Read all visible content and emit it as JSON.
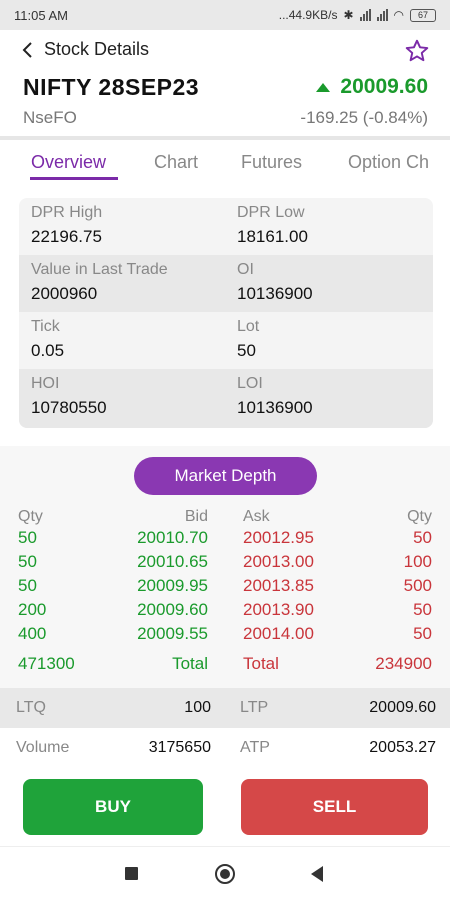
{
  "status_bar": {
    "time": "11:05 AM",
    "net_speed": "...44.9KB/s",
    "battery": "67"
  },
  "header": {
    "title": "Stock Details",
    "symbol": "NIFTY 28SEP23",
    "exchange": "NseFO",
    "ltp": "20009.60",
    "change": "-169.25 (-0.84%)",
    "icons": {
      "back": "chevron-left-icon",
      "favorite": "star-outline-icon",
      "trend": "up-arrow-icon"
    },
    "colors": {
      "up": "#1a9a2c",
      "accent": "#7b2aa8"
    }
  },
  "tabs": [
    {
      "label": "Overview"
    },
    {
      "label": "Chart"
    },
    {
      "label": "Futures"
    },
    {
      "label": "Option Ch"
    }
  ],
  "overview": {
    "rows": [
      [
        {
          "label": "DPR High",
          "value": "22196.75"
        },
        {
          "label": "DPR Low",
          "value": "18161.00"
        }
      ],
      [
        {
          "label": "Value in Last Trade",
          "value": "2000960"
        },
        {
          "label": "OI",
          "value": "10136900"
        }
      ],
      [
        {
          "label": "Tick",
          "value": "0.05"
        },
        {
          "label": "Lot",
          "value": "50"
        }
      ],
      [
        {
          "label": "HOI",
          "value": "10780550"
        },
        {
          "label": "LOI",
          "value": "10136900"
        }
      ]
    ]
  },
  "market_depth": {
    "button_label": "Market Depth",
    "headers": {
      "bid_qty": "Qty",
      "bid": "Bid",
      "ask": "Ask",
      "ask_qty": "Qty"
    },
    "rows": [
      {
        "bid_qty": "50",
        "bid": "20010.70",
        "ask": "20012.95",
        "ask_qty": "50"
      },
      {
        "bid_qty": "50",
        "bid": "20010.65",
        "ask": "20013.00",
        "ask_qty": "100"
      },
      {
        "bid_qty": "50",
        "bid": "20009.95",
        "ask": "20013.85",
        "ask_qty": "500"
      },
      {
        "bid_qty": "200",
        "bid": "20009.60",
        "ask": "20013.90",
        "ask_qty": "50"
      },
      {
        "bid_qty": "400",
        "bid": "20009.55",
        "ask": "20014.00",
        "ask_qty": "50"
      }
    ],
    "totals": {
      "bid_qty": "471300",
      "bid_label": "Total",
      "ask_label": "Total",
      "ask_qty": "234900"
    },
    "colors": {
      "bid": "#1a9a2c",
      "ask": "#c9353b"
    }
  },
  "stats": {
    "ltq_label": "LTQ",
    "ltq_value": "100",
    "ltp_label": "LTP",
    "ltp_value": "20009.60",
    "volume_label": "Volume",
    "volume_value": "3175650",
    "atp_label": "ATP",
    "atp_value": "20053.27"
  },
  "actions": {
    "buy": "BUY",
    "sell": "SELL",
    "colors": {
      "buy": "#1fa33a",
      "sell": "#d54848"
    }
  },
  "nav": {
    "icons": [
      "recents-square-icon",
      "home-circle-icon",
      "back-triangle-icon"
    ]
  }
}
